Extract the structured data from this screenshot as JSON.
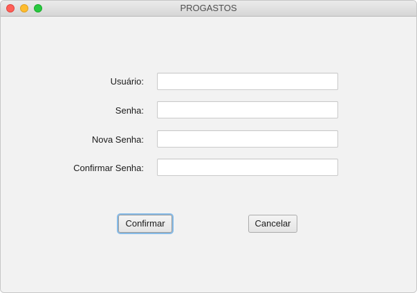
{
  "window": {
    "title": "PROGASTOS",
    "controls": [
      "close",
      "minimize",
      "zoom"
    ]
  },
  "form": {
    "fields": [
      {
        "label": "Usuário:",
        "value": ""
      },
      {
        "label": "Senha:",
        "value": ""
      },
      {
        "label": "Nova Senha:",
        "value": ""
      },
      {
        "label": "Confirmar Senha:",
        "value": ""
      }
    ]
  },
  "buttons": {
    "confirm_label": "Confirmar",
    "cancel_label": "Cancelar"
  },
  "colors": {
    "close": "#fe5f57",
    "minimize": "#febc2e",
    "zoom": "#28c840",
    "focus_ring": "#86bbe8",
    "background": "#f2f2f2"
  }
}
